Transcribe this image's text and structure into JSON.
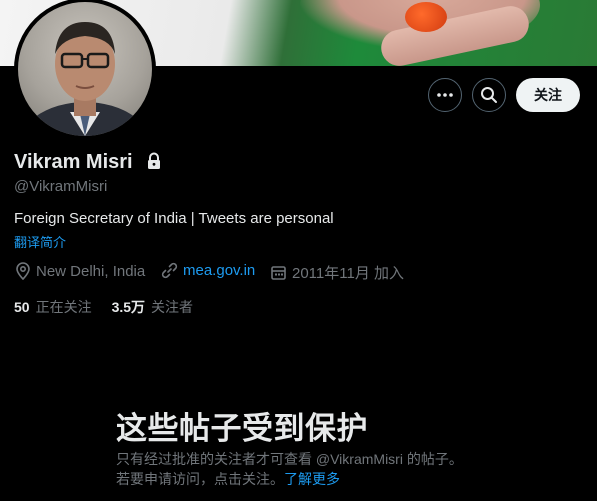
{
  "profile": {
    "name": "Vikram Misri",
    "handle": "@VikramMisri",
    "bio": "Foreign Secretary of India | Tweets are personal",
    "translate_bio": "翻译简介",
    "location": "New Delhi, India",
    "website": "mea.gov.in",
    "joined": "2011年11月 加入",
    "following_count": "50",
    "following_label": "正在关注",
    "followers_count": "3.5万",
    "followers_label": "关注者"
  },
  "actions": {
    "more_icon": "more-icon",
    "search_icon": "search-icon",
    "follow_label": "关注"
  },
  "protected": {
    "title": "这些帖子受到保护",
    "description": "只有经过批准的关注者才可查看 @VikramMisri 的帖子。若要申请访问，点击关注。",
    "learn_more": "了解更多"
  },
  "colors": {
    "background": "#000000",
    "text": "#e7e9ea",
    "muted": "#71767b",
    "accent": "#1d9bf0"
  }
}
